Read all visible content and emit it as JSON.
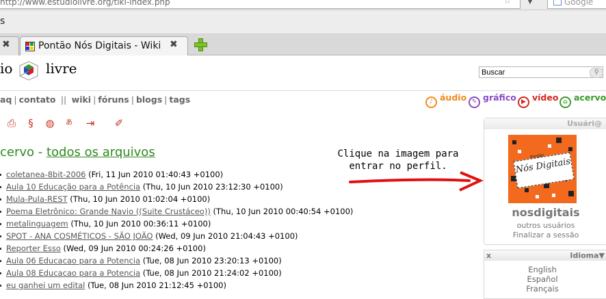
{
  "browser": {
    "url": "http://www.estudiolivre.org/tiki-index.php",
    "web_search_placeholder": "Google",
    "menu_fragment": "s",
    "tabs": [
      {
        "title": "",
        "active": false
      },
      {
        "title": "Pontão Nós Digitais - Wiki",
        "active": true
      }
    ]
  },
  "site": {
    "logo_left": "io",
    "logo_right": "livre",
    "search_value": "Buscar",
    "nav": [
      "aq",
      "contato",
      "||",
      "wiki",
      "fóruns",
      "blogs",
      "tags"
    ],
    "media_types": [
      {
        "label": "áudio",
        "icon": "audio-icon",
        "color": "#f0891e"
      },
      {
        "label": "gráfico",
        "icon": "graphic-icon",
        "color": "#8a4bc4"
      },
      {
        "label": "vídeo",
        "icon": "video-icon",
        "color": "#d4261c"
      },
      {
        "label": "acervo",
        "icon": "archive-icon",
        "color": "#3a9a2a"
      }
    ],
    "toolbar_icons": [
      "print-icon",
      "scroll-icon",
      "globe-icon",
      "translate-icon",
      "import-icon",
      "edit-icon"
    ]
  },
  "main": {
    "title_prefix": "cervo - ",
    "title_link": "todos os arquivos",
    "files": [
      {
        "name": "coletanea-8bit-2006",
        "date": "(Fri, 11 Jun 2010 01:40:43 +0100)"
      },
      {
        "name": "Aula 10 Educação para a Potência",
        "date": "(Thu, 10 Jun 2010 23:12:30 +0100)"
      },
      {
        "name": "Mula-Pula-REST",
        "date": "(Thu, 10 Jun 2010 01:02:04 +0100)"
      },
      {
        "name": "Poema Eletrônico: Grande Navio ((Suite Crustáceo))",
        "date": "(Thu, 10 Jun 2010 00:40:54 +0100)"
      },
      {
        "name": "metalinguagem",
        "date": "(Thu, 10 Jun 2010 00:36:11 +0100)"
      },
      {
        "name": "SPOT - ANA COSMÉTICOS - SÃO JOÃO",
        "date": "(Wed, 09 Jun 2010 21:04:43 +0100)"
      },
      {
        "name": "Reporter Esso",
        "date": "(Wed, 09 Jun 2010 00:24:26 +0100)"
      },
      {
        "name": "Aula 06 Educacao para a Potencia",
        "date": "(Tue, 08 Jun 2010 23:20:13 +0100)"
      },
      {
        "name": "Aula 08 Educacao para a Potencia",
        "date": "(Tue, 08 Jun 2010 21:24:02 +0100)"
      },
      {
        "name": "eu ganhei um edital",
        "date": "(Tue, 08 Jun 2010 21:12:45 +0100)"
      }
    ]
  },
  "annotation": {
    "line1": "Clique na imagem para",
    "line2": "entrar no perfil."
  },
  "sidebar": {
    "user_header": "Usuári@",
    "avatar_caption": "Nós Digitais",
    "avatar_small": "Pontão",
    "username": "nosdigitais",
    "other_users": "outros usuários",
    "logout": "Finalizar a sessão",
    "lang_close": "x",
    "lang_header": "Idioma▼",
    "languages": [
      "English",
      "Español",
      "Français"
    ]
  }
}
